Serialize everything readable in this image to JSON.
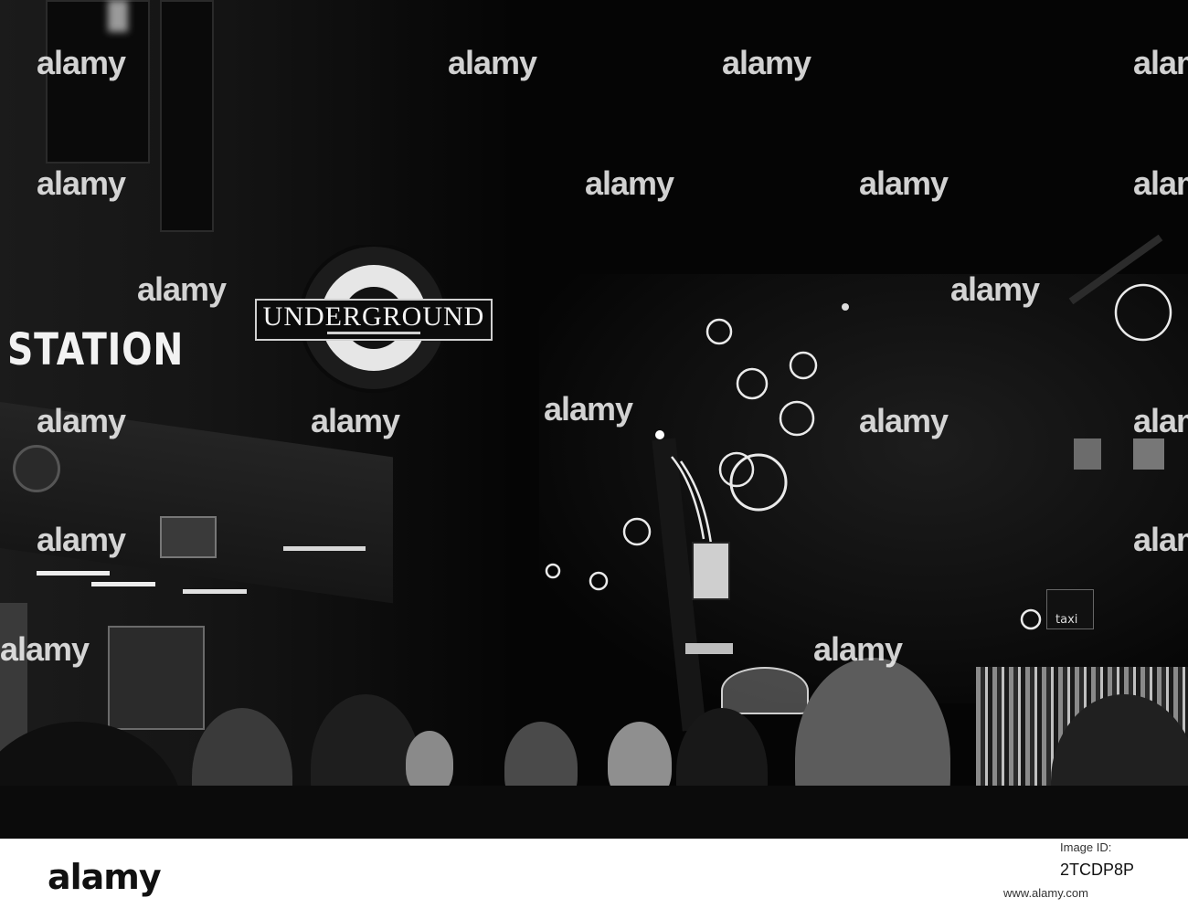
{
  "photo": {
    "station_sign": "STATION",
    "underground_sign": "UNDERGROUND",
    "taxi_sign": "taxi",
    "bg_color": "#050505",
    "highlight_color": "#f4f4f4"
  },
  "watermarks": {
    "overlay": [
      "alamy",
      "alamy",
      "alamy",
      "alamy",
      "alamy",
      "alamy",
      "alamy",
      "alamy",
      "alamy",
      "alamy",
      "alamy",
      "alamy",
      "alamy",
      "alamy",
      "alamy",
      "alamy",
      "alamy",
      "alamy",
      "alamy"
    ]
  },
  "footer": {
    "logo": "alamy",
    "image_id_label": "Image ID:",
    "image_id": "2TCDP8P",
    "url": "www.alamy.com"
  }
}
